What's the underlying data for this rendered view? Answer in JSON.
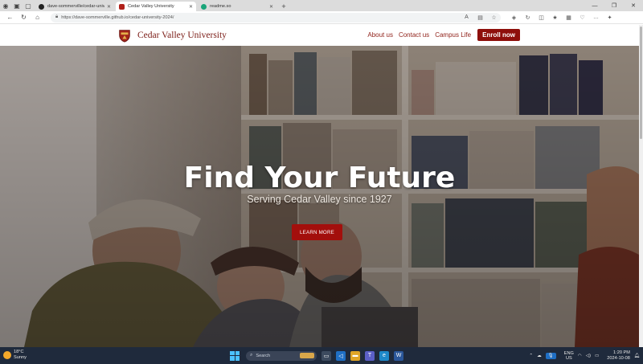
{
  "browser": {
    "tabs": [
      {
        "title": "dave-sommerville/cedar-univers",
        "icon": "github-icon",
        "active": false
      },
      {
        "title": "Cedar Valley University",
        "icon": "university-crest-icon",
        "active": true
      },
      {
        "title": "readme.so",
        "icon": "readme-icon",
        "active": false
      }
    ],
    "new_tab_label": "+",
    "url": "https://dave-sommerville.github.io/cedar-university-2024/"
  },
  "site": {
    "brand": "Cedar Valley University",
    "nav": {
      "about": "About us",
      "contact": "Contact us",
      "campus": "Campus Life",
      "enroll": "Enroll now"
    },
    "hero": {
      "title": "Find Your Future",
      "subtitle": "Serving Cedar Valley since 1927",
      "cta": "LEARN MORE"
    }
  },
  "taskbar": {
    "weather": {
      "temp": "18°C",
      "condition": "Sunny"
    },
    "search_placeholder": "Search",
    "lang": {
      "line1": "ENG",
      "line2": "US"
    },
    "clock": {
      "time": "1:20 PM",
      "date": "2024-10-08"
    }
  },
  "colors": {
    "brand": "#7a1a14",
    "nav_link": "#8f1f17",
    "enroll_bg": "#8e0f0b",
    "hero_button": "#a30f0c",
    "taskbar": "#1f2a3c"
  }
}
